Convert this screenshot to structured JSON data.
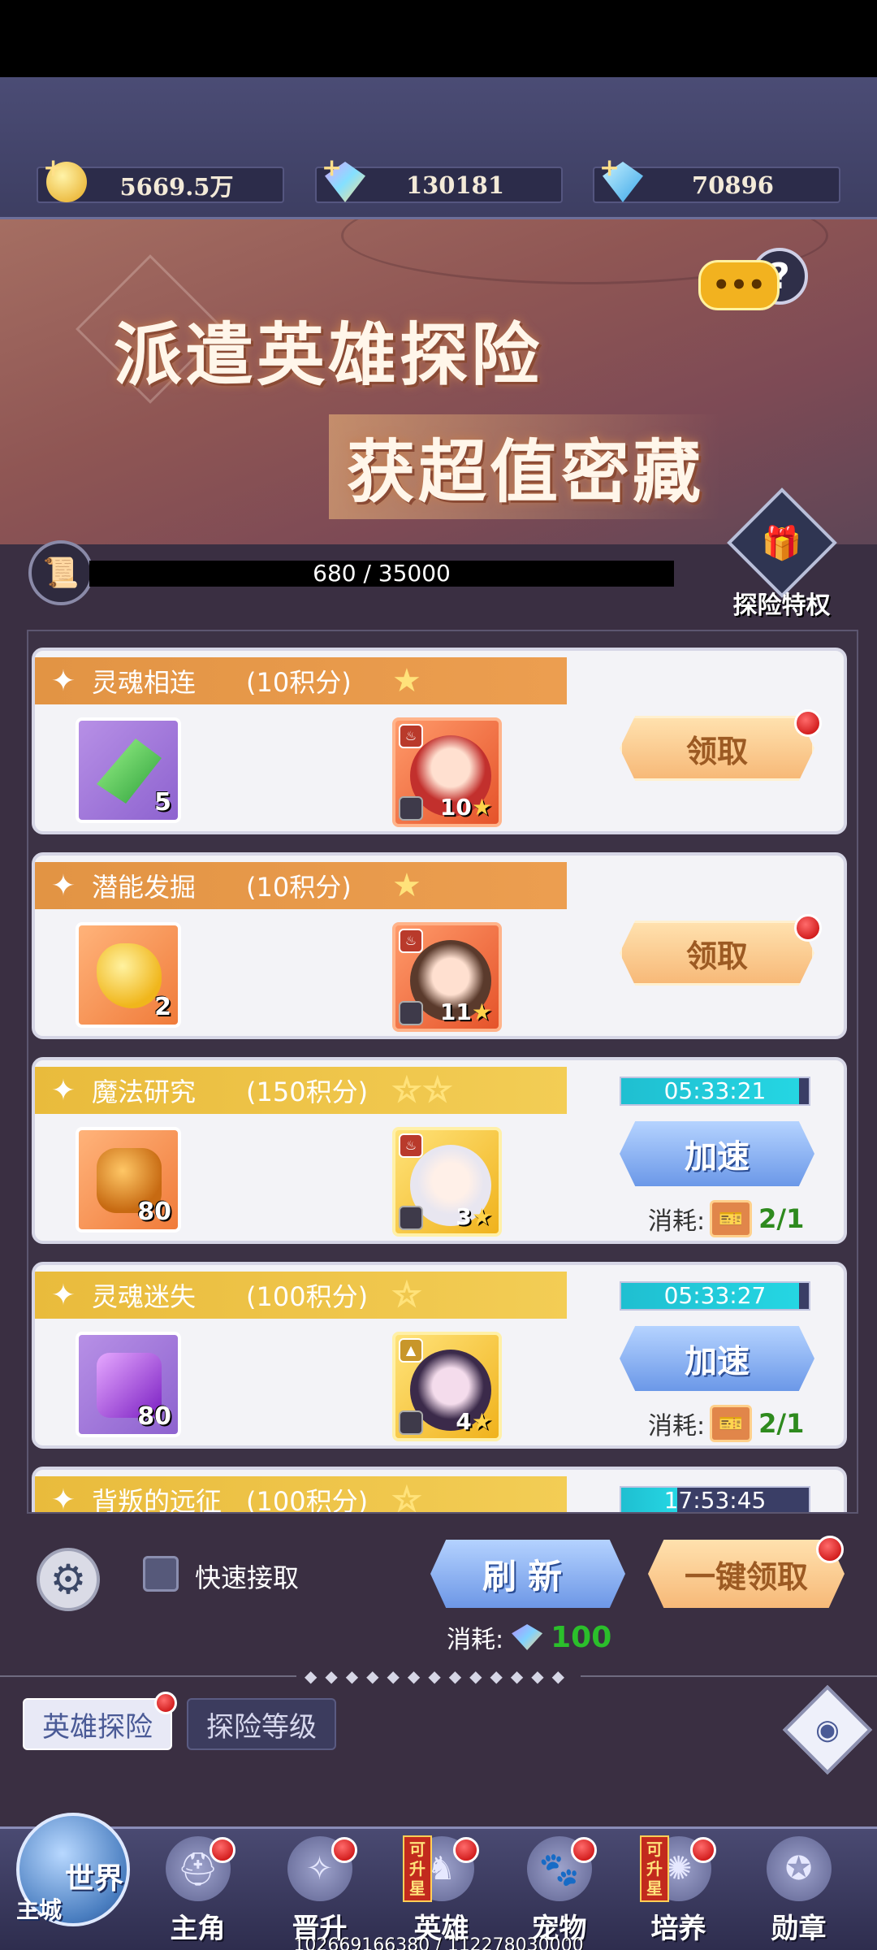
{
  "resources": {
    "gold": {
      "value": "5669.5万",
      "icon": "gold-coin-icon"
    },
    "rainbow": {
      "value": "130181",
      "icon": "rainbow-diamond-icon"
    },
    "diamond": {
      "value": "70896",
      "icon": "blue-diamond-icon"
    }
  },
  "banner": {
    "title_line1": "派遣英雄探险",
    "title_line2": "获超值密藏",
    "chat_icon": "chat-bubble-icon",
    "help_icon": "?"
  },
  "progress": {
    "text": "680 / 35000",
    "current": 680,
    "max": 35000
  },
  "privilege": {
    "label": "探险特权"
  },
  "quests": [
    {
      "name": "灵魂相连",
      "points": "(10积分)",
      "stars": "★",
      "style": "orange",
      "item_count": "5",
      "item_color": "green",
      "hero_level": "10",
      "hero_frame": "orange",
      "action": "领取",
      "action_type": "claim",
      "has_dot": true
    },
    {
      "name": "潜能发掘",
      "points": "(10积分)",
      "stars": "★",
      "style": "orange",
      "item_count": "2",
      "item_color": "gold",
      "hero_level": "11",
      "hero_frame": "orange",
      "action": "领取",
      "action_type": "claim",
      "has_dot": true
    },
    {
      "name": "魔法研究",
      "points": "(150积分)",
      "stars": "☆☆",
      "style": "yellow",
      "item_count": "80",
      "item_color": "amber",
      "hero_level": "3",
      "hero_frame": "gold",
      "action": "加速",
      "action_type": "speed",
      "timer": "05:33:21",
      "timer_progress": 0.95,
      "cost_label": "消耗:",
      "cost_amount": "2/1",
      "has_dot": false
    },
    {
      "name": "灵魂迷失",
      "points": "(100积分)",
      "stars": "☆",
      "style": "yellow",
      "item_count": "80",
      "item_color": "purple",
      "hero_level": "4",
      "hero_frame": "gold",
      "action": "加速",
      "action_type": "speed",
      "timer": "05:33:27",
      "timer_progress": 0.95,
      "cost_label": "消耗:",
      "cost_amount": "2/1",
      "has_dot": false
    },
    {
      "name": "背叛的远征",
      "points": "(100积分)",
      "stars": "☆",
      "style": "yellow",
      "timer": "17:53:45"
    }
  ],
  "controls": {
    "quick_claim_label": "快速接取",
    "refresh_label": "刷新",
    "one_key_label": "一键领取",
    "refresh_cost_label": "消耗:",
    "refresh_cost": "100"
  },
  "tabs": {
    "active": "英雄探险",
    "inactive": "探险等级"
  },
  "nav": {
    "world_label": "世界",
    "city_label": "主城",
    "items": [
      {
        "label": "主角",
        "icon": "hero-helmet-icon",
        "dot": true,
        "badge": ""
      },
      {
        "label": "晋升",
        "icon": "wings-icon",
        "dot": true,
        "badge": ""
      },
      {
        "label": "英雄",
        "icon": "knight-helmet-icon",
        "dot": true,
        "badge": "可升星"
      },
      {
        "label": "宠物",
        "icon": "pet-icon",
        "dot": true,
        "badge": ""
      },
      {
        "label": "培养",
        "icon": "cultivate-icon",
        "dot": true,
        "badge": "可升星"
      },
      {
        "label": "勋章",
        "icon": "medal-icon",
        "dot": false,
        "badge": ""
      }
    ]
  },
  "footer": {
    "text": "102669166380 / 112278030000"
  }
}
